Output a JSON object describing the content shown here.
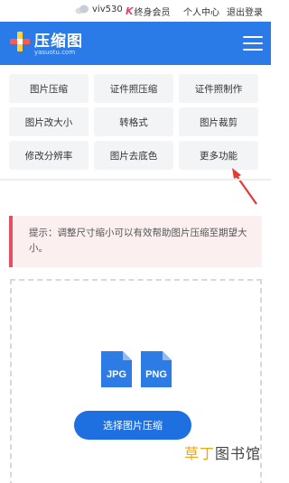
{
  "topbar": {
    "username": "viv530",
    "vip_label": "终身会员",
    "vip_mark": "K",
    "personal_center": "个人中心",
    "logout": "退出登录"
  },
  "header": {
    "brand": "压缩图",
    "brand_sub": "yasuotu.com",
    "colors": {
      "header_bg": "#2a7be8"
    }
  },
  "tools": [
    "图片压缩",
    "证件照压缩",
    "证件照制作",
    "图片改大小",
    "转格式",
    "图片裁剪",
    "修改分辨率",
    "图片去底色",
    "更多功能"
  ],
  "notice": {
    "text": "提示：调整尺寸缩小可以有效帮助图片压缩至期望大小。",
    "accent": "#e84e63"
  },
  "upload": {
    "jpg_label": "JPG",
    "png_label": "PNG",
    "button_label": "选择图片压缩",
    "button_color": "#1e6fe0"
  },
  "watermark": {
    "accent": "草丁",
    "rest": "图书馆"
  },
  "annotation": {
    "arrow_color": "#e53935"
  }
}
